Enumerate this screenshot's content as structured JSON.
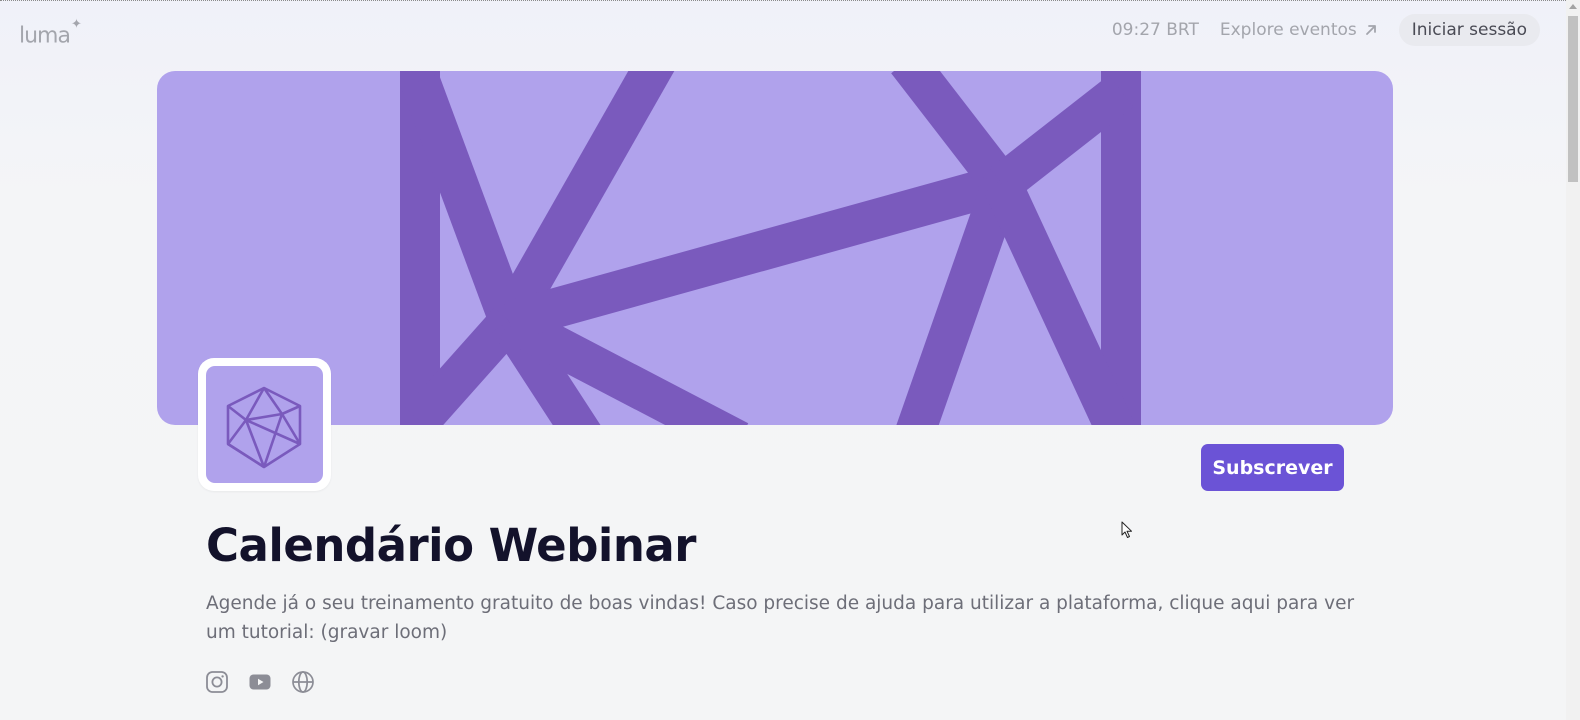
{
  "header": {
    "logo_text": "luma",
    "logo_mark": "✦",
    "clock": "09:27 BRT",
    "explore_label": "Explore eventos",
    "explore_icon": "arrow-up-right-icon",
    "signin_label": "Iniciar sessão"
  },
  "calendar": {
    "subscribe_label": "Subscrever",
    "title": "Calendário Webinar",
    "description": "Agende já o seu treinamento gratuito de boas vindas! Caso precise de ajuda para utilizar a plataforma, clique aqui para ver um tutorial: (gravar loom)"
  },
  "socials": [
    {
      "icon": "instagram-icon"
    },
    {
      "icon": "youtube-icon"
    },
    {
      "icon": "globe-icon"
    }
  ],
  "colors": {
    "accent": "#6b53d6",
    "banner_bg": "#b0a2ec",
    "banner_lines": "#7a5abd"
  }
}
